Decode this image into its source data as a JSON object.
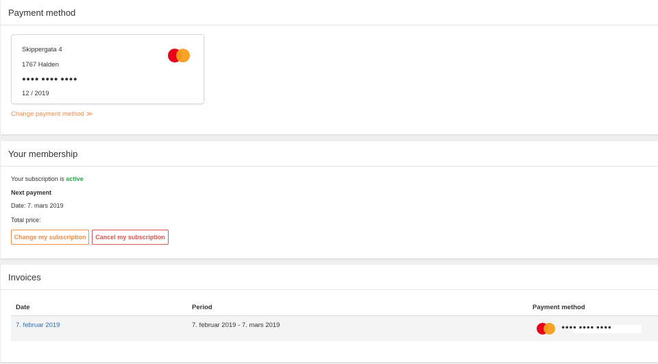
{
  "payment": {
    "title": "Payment method",
    "card": {
      "address_line1": "Skippergata 4",
      "address_line2": "1767 Halden",
      "masked_number": "●●●● ●●●● ●●●●",
      "expiry": "12 / 2019",
      "brand_icon": "mastercard-icon"
    },
    "change_link": "Change payment method ≫"
  },
  "membership": {
    "title": "Your membership",
    "status_prefix": "Your subscription is ",
    "status_value": "active",
    "next_payment_label": "Next payment",
    "date_line": "Date: 7. mars 2019",
    "total_price_label": "Total price:",
    "change_button": "Change my subscription",
    "cancel_button": "Cancel my subscription"
  },
  "invoices": {
    "title": "Invoices",
    "columns": [
      "Date",
      "Period",
      "Payment method"
    ],
    "rows": [
      {
        "date": "7. februar 2019",
        "period": "7. februar 2019 - 7. mars 2019",
        "masked_card": "●●●● ●●●● ●●●●",
        "card_icon": "mastercard-icon"
      }
    ]
  },
  "colors": {
    "accent_orange": "#f08c4a",
    "danger_red": "#d9534f",
    "link_blue": "#2a6fb5",
    "active_green": "#2aa84a"
  }
}
